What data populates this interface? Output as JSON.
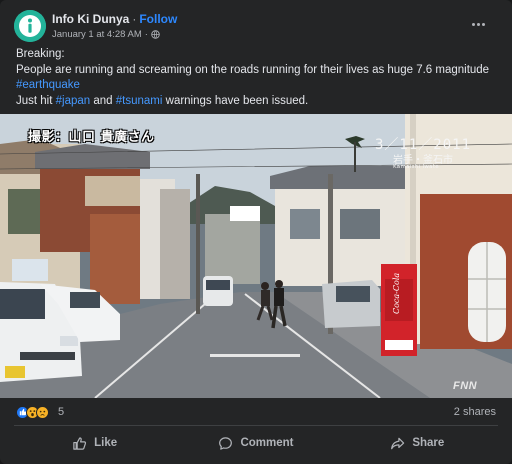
{
  "post": {
    "page_name": "Info Ki Dunya",
    "separator": "·",
    "follow_label": "Follow",
    "timestamp": "January 1 at 4:28 AM",
    "meta_dot": "·",
    "audience_icon": "globe-icon",
    "more_icon": "more-horizontal-icon",
    "text": {
      "line1": "Breaking:",
      "line2": "People are running and screaming on the roads running for their lives as huge 7.6 magnitude",
      "hashtag_earthquake": "#earthquake",
      "line4_prefix": "Just hit ",
      "hashtag_japan": "#japan",
      "line4_mid": " and ",
      "hashtag_tsunami": "#tsunami",
      "line4_suffix": " warnings have been issued."
    }
  },
  "media": {
    "overlay_caption": "撮影：山口 貴廣さん",
    "overlay_date": "3／11／2011",
    "overlay_place": "岩手・釜石市",
    "overlay_place_romaji": "Kamaishi Iwate",
    "broadcaster_logo": "FNN",
    "vending_machine_text": "Coca-Cola"
  },
  "engagement": {
    "reaction_icons": [
      "like-icon",
      "wow-icon",
      "sad-icon"
    ],
    "reaction_count": "5",
    "shares_text": "2 shares"
  },
  "actions": {
    "like_label": "Like",
    "comment_label": "Comment",
    "share_label": "Share"
  },
  "colors": {
    "card_bg": "#242526",
    "text_primary": "#e4e6eb",
    "text_secondary": "#b0b3b8",
    "link_blue": "#4599ff",
    "follow_blue": "#2d88ff",
    "avatar_bg": "#23b39a"
  }
}
